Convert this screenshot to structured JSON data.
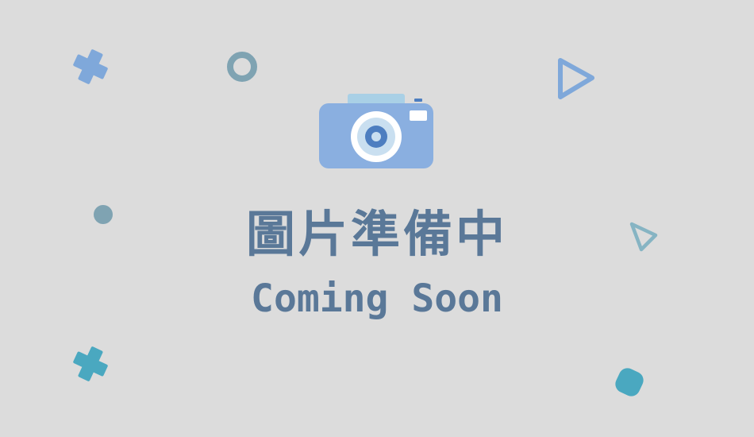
{
  "placeholder": {
    "title_zh": "圖片準備中",
    "title_en": "Coming Soon",
    "icon": "camera-icon"
  },
  "colors": {
    "background": "#dcdcdc",
    "text": "#5a7898",
    "camera_body": "#8aafe0",
    "camera_top": "#a9d0e6",
    "lens_ring": "#ffffff",
    "lens_inner": "#c9dff0",
    "lens_core": "#4d7ec0",
    "deco_blue": "#7fa8da",
    "deco_gray_teal": "#7fa3b2",
    "deco_teal": "#4aa8c0",
    "deco_triangle_teal": "#86b4c3"
  },
  "decorations": [
    "cross-icon",
    "ring-icon",
    "triangle-icon",
    "dot-icon",
    "triangle-icon",
    "cross-icon",
    "rounded-square-icon"
  ]
}
